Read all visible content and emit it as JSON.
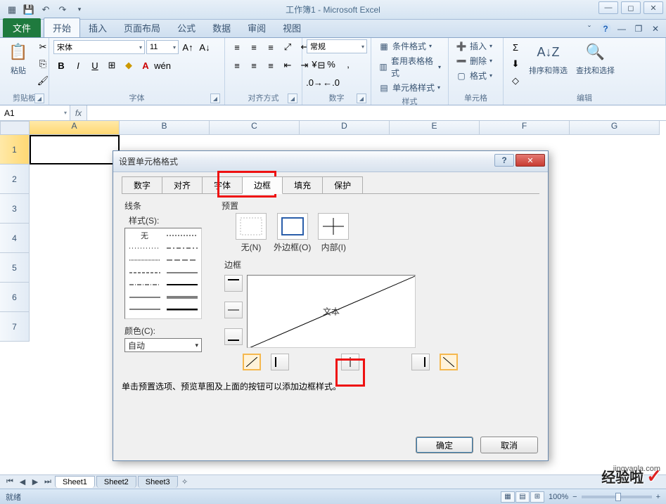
{
  "title": "工作簿1 - Microsoft Excel",
  "ribbon_tabs": {
    "file": "文件",
    "home": "开始",
    "insert": "插入",
    "layout": "页面布局",
    "formula": "公式",
    "data": "数据",
    "review": "审阅",
    "view": "视图"
  },
  "groups": {
    "clipboard": {
      "label": "剪贴板",
      "paste": "粘贴"
    },
    "font": {
      "label": "字体",
      "name": "宋体",
      "size": "11"
    },
    "align": {
      "label": "对齐方式"
    },
    "number": {
      "label": "数字",
      "format": "常规"
    },
    "styles": {
      "label": "样式",
      "cond": "条件格式",
      "table": "套用表格格式",
      "cell": "单元格样式"
    },
    "cells": {
      "label": "单元格",
      "insert": "插入",
      "delete": "删除",
      "format": "格式"
    },
    "edit": {
      "label": "编辑",
      "sort": "排序和筛选",
      "find": "查找和选择"
    }
  },
  "name_box": "A1",
  "columns": [
    "A",
    "B",
    "C",
    "D",
    "E",
    "F",
    "G"
  ],
  "rows": [
    "1",
    "2",
    "3",
    "4",
    "5",
    "6",
    "7"
  ],
  "sheets": [
    "Sheet1",
    "Sheet2",
    "Sheet3"
  ],
  "status": {
    "ready": "就绪",
    "zoom": "100%"
  },
  "dialog": {
    "title": "设置单元格格式",
    "tabs": [
      "数字",
      "对齐",
      "字体",
      "边框",
      "填充",
      "保护"
    ],
    "line_section": "线条",
    "style_label": "样式(S):",
    "none_style": "无",
    "color_label": "颜色(C):",
    "color_auto": "自动",
    "preset_label": "预置",
    "presets": {
      "none": "无(N)",
      "outer": "外边框(O)",
      "inner": "内部(I)"
    },
    "border_label": "边框",
    "preview_text": "文本",
    "hint": "单击预置选项、预览草图及上面的按钮可以添加边框样式。",
    "ok": "确定",
    "cancel": "取消"
  },
  "watermark": {
    "brand": "经验啦",
    "url": "jingyanla.com"
  }
}
